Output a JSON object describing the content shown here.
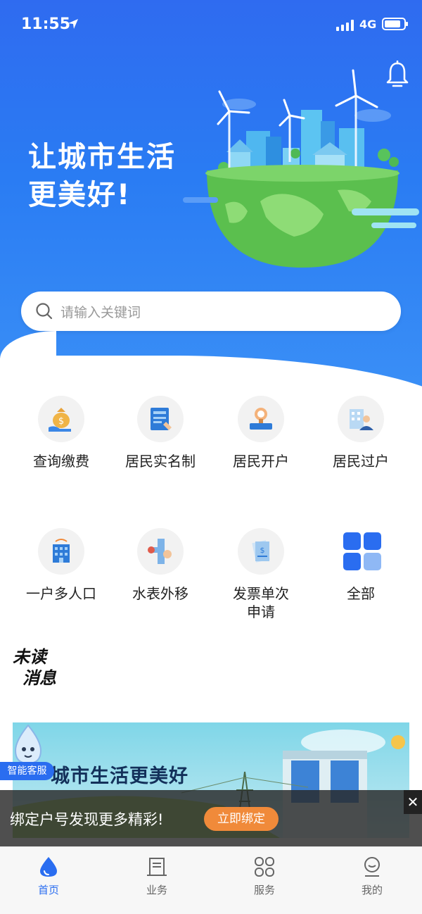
{
  "status_bar": {
    "time": "11:55",
    "network": "4G"
  },
  "hero": {
    "slogan_line1": "让城市生活",
    "slogan_line2": "更美好!"
  },
  "search": {
    "placeholder": "请输入关键词"
  },
  "services": [
    {
      "label": "查询缴费",
      "icon": "money-bag-icon"
    },
    {
      "label": "居民实名制",
      "icon": "id-card-icon"
    },
    {
      "label": "居民开户",
      "icon": "water-meter-icon"
    },
    {
      "label": "居民过户",
      "icon": "building-person-icon"
    },
    {
      "label": "一户多人口",
      "icon": "apartment-icon"
    },
    {
      "label": "水表外移",
      "icon": "pipe-valve-icon"
    },
    {
      "label": "发票单次",
      "label2": "申请",
      "icon": "invoice-icon"
    },
    {
      "label": "全部",
      "icon": "grid-icon"
    }
  ],
  "unread": {
    "line1": "未读",
    "line2": "消息"
  },
  "banner": {
    "title": "城市生活更美好"
  },
  "service_tag": "智能客服",
  "bind_bar": {
    "text": "绑定户号发现更多精彩!",
    "button": "立即绑定",
    "close": "✕"
  },
  "tabs": [
    {
      "label": "首页",
      "icon": "water-drop-icon",
      "active": true
    },
    {
      "label": "业务",
      "icon": "document-icon",
      "active": false
    },
    {
      "label": "服务",
      "icon": "four-leaf-icon",
      "active": false
    },
    {
      "label": "我的",
      "icon": "user-icon",
      "active": false
    }
  ],
  "colors": {
    "primary": "#2a6df0",
    "accent": "#f08a3a"
  }
}
